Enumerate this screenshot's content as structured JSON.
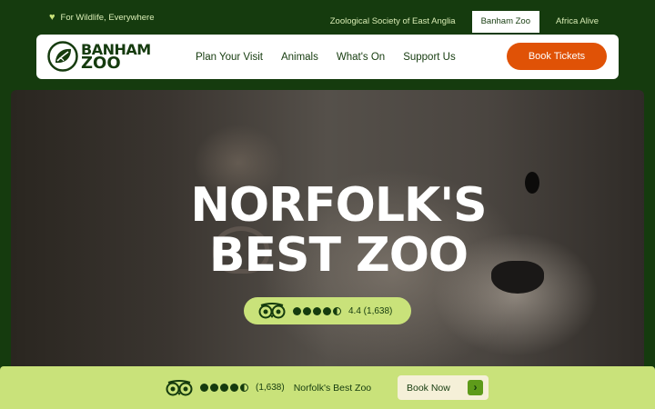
{
  "top": {
    "tagline": "For Wildlife, Everywhere",
    "links": [
      {
        "label": "Zoological Society of East Anglia"
      },
      {
        "label": "Banham Zoo"
      },
      {
        "label": "Africa Alive"
      }
    ]
  },
  "header": {
    "logo_line1": "BANHAM",
    "logo_line2": "ZOO",
    "menu": [
      "Plan Your Visit",
      "Animals",
      "What's On",
      "Support Us"
    ],
    "cta": "Book Tickets"
  },
  "hero": {
    "title_line1": "NORFOLK'S",
    "title_line2": "BEST ZOO",
    "rating_text": "4.4 (1,638)",
    "rating_bubbles": 4.5
  },
  "bottom": {
    "review_count": "(1,638)",
    "label": "Norfolk's Best Zoo",
    "cta": "Book Now"
  },
  "colors": {
    "brand_dark": "#153b0e",
    "accent_green": "#c9e27a",
    "cta_orange": "#e05206"
  }
}
